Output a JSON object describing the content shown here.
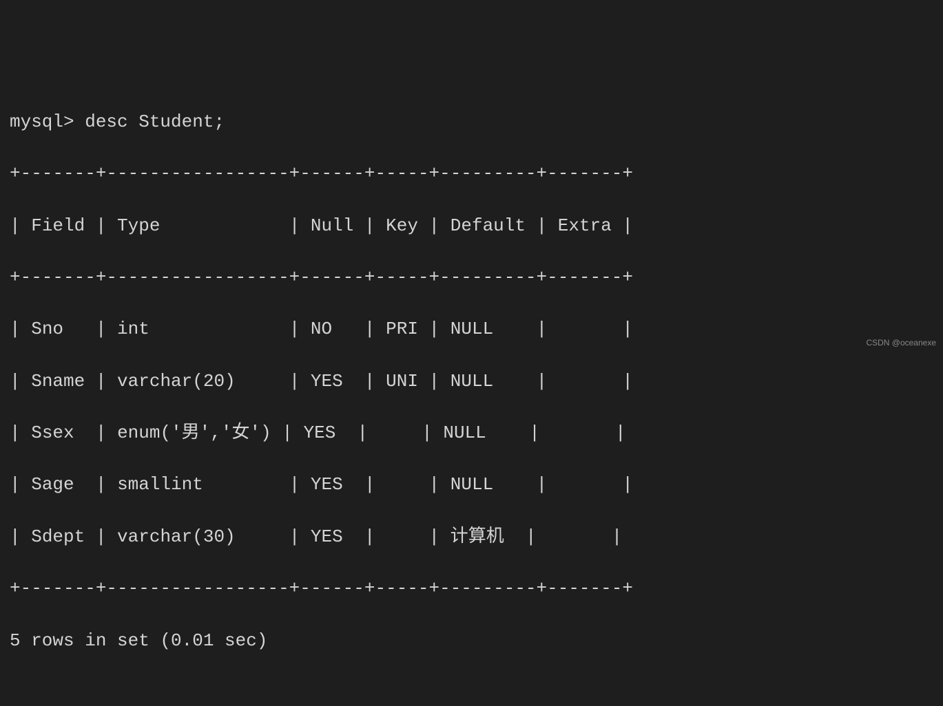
{
  "prompt": "mysql> desc Student;",
  "borders": {
    "top": "+-------+-----------------+------+-----+---------+-------+",
    "mid": "+-------+-----------------+------+-----+---------+-------+",
    "bottom": "+-------+-----------------+------+-----+---------+-------+"
  },
  "header": {
    "col0": "Field",
    "col1": "Type",
    "col2": "Null",
    "col3": "Key",
    "col4": "Default",
    "col5": "Extra"
  },
  "rows": [
    {
      "col0": "Sno",
      "col1": "int",
      "col2": "NO",
      "col3": "PRI",
      "col4": "NULL",
      "col5": ""
    },
    {
      "col0": "Sname",
      "col1": "varchar(20)",
      "col2": "YES",
      "col3": "UNI",
      "col4": "NULL",
      "col5": ""
    },
    {
      "col0": "Ssex",
      "col1": "enum('男','女')",
      "col2": "YES",
      "col3": "",
      "col4": "NULL",
      "col5": ""
    },
    {
      "col0": "Sage",
      "col1": "smallint",
      "col2": "YES",
      "col3": "",
      "col4": "NULL",
      "col5": ""
    },
    {
      "col0": "Sdept",
      "col1": "varchar(30)",
      "col2": "YES",
      "col3": "",
      "col4": "计算机",
      "col5": ""
    }
  ],
  "footer": "5 rows in set (0.01 sec)",
  "watermark": "CSDN @oceanexe",
  "chart_data": {
    "type": "table",
    "title": "desc Student",
    "columns": [
      "Field",
      "Type",
      "Null",
      "Key",
      "Default",
      "Extra"
    ],
    "data": [
      [
        "Sno",
        "int",
        "NO",
        "PRI",
        "NULL",
        ""
      ],
      [
        "Sname",
        "varchar(20)",
        "YES",
        "UNI",
        "NULL",
        ""
      ],
      [
        "Ssex",
        "enum('男','女')",
        "YES",
        "",
        "NULL",
        ""
      ],
      [
        "Sage",
        "smallint",
        "YES",
        "",
        "NULL",
        ""
      ],
      [
        "Sdept",
        "varchar(30)",
        "YES",
        "",
        "计算机",
        ""
      ]
    ]
  }
}
